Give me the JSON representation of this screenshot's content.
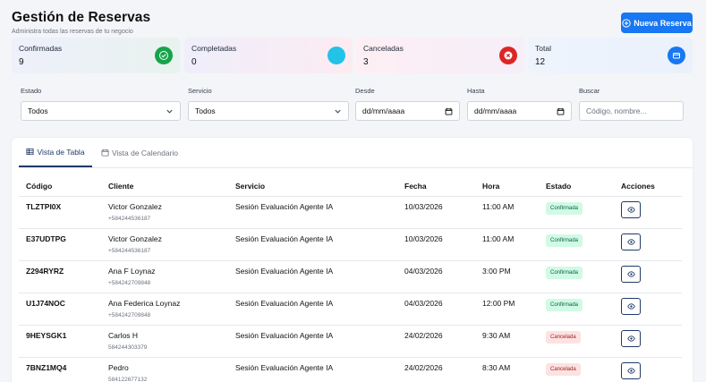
{
  "header": {
    "title": "Gestión de Reservas",
    "subtitle": "Administra todas las reservas de tu negocio",
    "new_button": "Nueva Reserva"
  },
  "stats": [
    {
      "label": "Confirmadas",
      "value": "9",
      "icon": "check-circle-icon",
      "color": "#16a34a"
    },
    {
      "label": "Completadas",
      "value": "0",
      "icon": "dot-circle-icon",
      "color": "#22c3e6"
    },
    {
      "label": "Canceladas",
      "value": "3",
      "icon": "x-circle-icon",
      "color": "#dc2626"
    },
    {
      "label": "Total",
      "value": "12",
      "icon": "wallet-icon",
      "color": "#1877f2"
    }
  ],
  "filters": {
    "estado": {
      "label": "Estado",
      "value": "Todos"
    },
    "servicio": {
      "label": "Servicio",
      "value": "Todos"
    },
    "desde": {
      "label": "Desde",
      "value": "dd/mm/aaaa"
    },
    "hasta": {
      "label": "Hasta",
      "value": "dd/mm/aaaa"
    },
    "buscar": {
      "label": "Buscar",
      "placeholder": "Código, nombre..."
    }
  },
  "tabs": {
    "table": "Vista de Tabla",
    "calendar": "Vista de Calendario"
  },
  "table": {
    "headers": [
      "Código",
      "Cliente",
      "Servicio",
      "Fecha",
      "Hora",
      "Estado",
      "Acciones"
    ],
    "rows": [
      {
        "code": "TLZTPI0X",
        "client": "Victor Gonzalez",
        "phone": "+584244536187",
        "service": "Sesión Evaluación Agente IA",
        "date": "10/03/2026",
        "time": "11:00 AM",
        "status": "Confirmada",
        "status_type": "ok"
      },
      {
        "code": "E37UDTPG",
        "client": "Victor Gonzalez",
        "phone": "+584244536187",
        "service": "Sesión Evaluación Agente IA",
        "date": "10/03/2026",
        "time": "11:00 AM",
        "status": "Confirmada",
        "status_type": "ok"
      },
      {
        "code": "Z294RYRZ",
        "client": "Ana F Loynaz",
        "phone": "+584242709848",
        "service": "Sesión Evaluación Agente IA",
        "date": "04/03/2026",
        "time": "3:00 PM",
        "status": "Confirmada",
        "status_type": "ok"
      },
      {
        "code": "U1J74NOC",
        "client": "Ana Federica Loynaz",
        "phone": "+584242709848",
        "service": "Sesión Evaluación Agente IA",
        "date": "04/03/2026",
        "time": "12:00 PM",
        "status": "Confirmada",
        "status_type": "ok"
      },
      {
        "code": "9HEYSGK1",
        "client": "Carlos H",
        "phone": "584244303379",
        "service": "Sesión Evaluación Agente IA",
        "date": "24/02/2026",
        "time": "9:30 AM",
        "status": "Cancelada",
        "status_type": "cancel"
      },
      {
        "code": "7BNZ1MQ4",
        "client": "Pedro",
        "phone": "584122677132",
        "service": "Sesión Evaluación Agente IA",
        "date": "24/02/2026",
        "time": "8:30 AM",
        "status": "Cancelada",
        "status_type": "cancel"
      }
    ]
  }
}
